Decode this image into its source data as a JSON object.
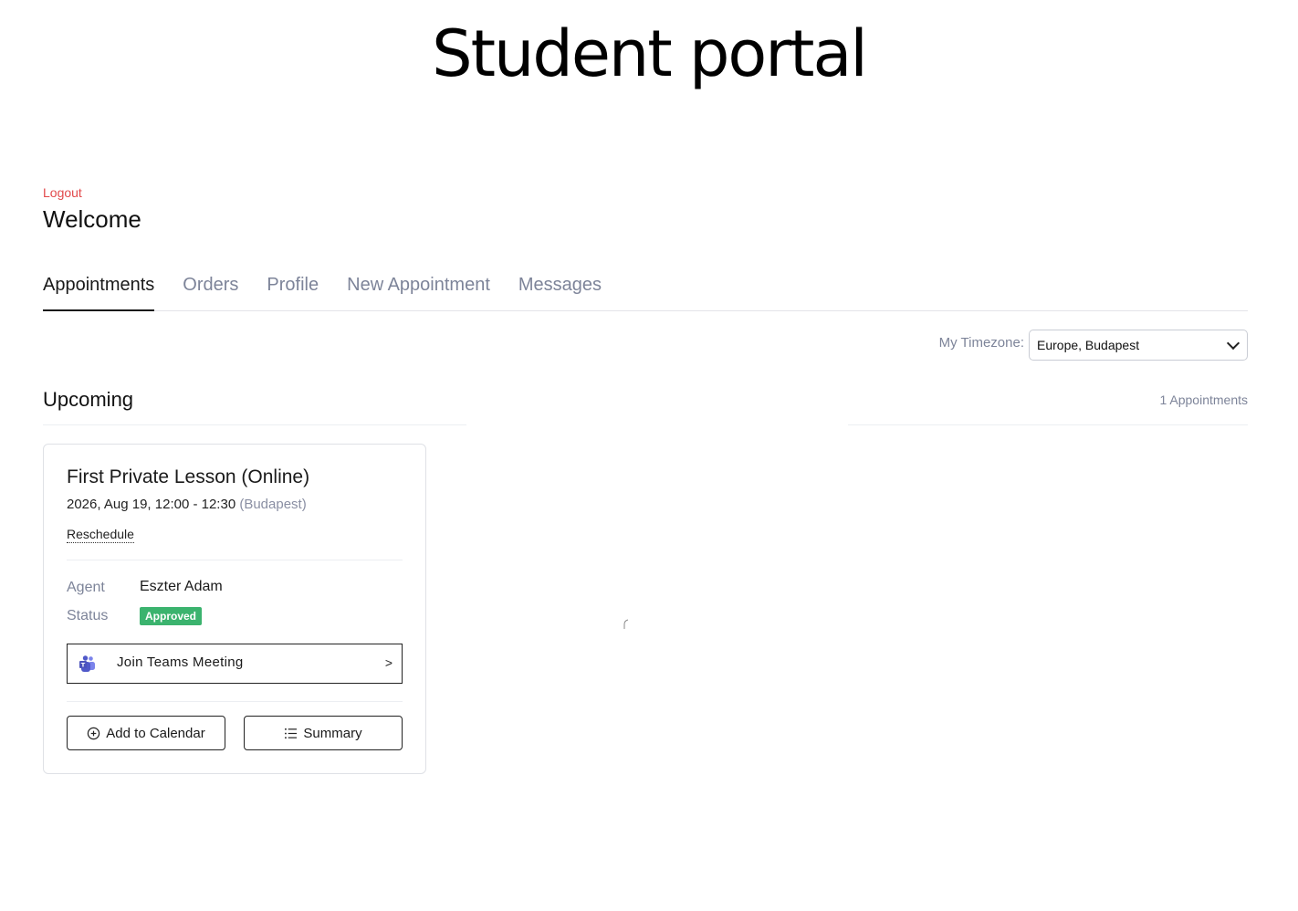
{
  "page": {
    "title": "Student portal"
  },
  "header": {
    "logout_label": "Logout",
    "welcome_text": "Welcome"
  },
  "tabs": [
    {
      "label": "Appointments",
      "active": true
    },
    {
      "label": "Orders",
      "active": false
    },
    {
      "label": "Profile",
      "active": false
    },
    {
      "label": "New Appointment",
      "active": false
    },
    {
      "label": "Messages",
      "active": false
    }
  ],
  "timezone": {
    "label": "My Timezone:",
    "selected": "Europe, Budapest"
  },
  "upcoming": {
    "title": "Upcoming",
    "count_text": "1 Appointments"
  },
  "appointment": {
    "title": "First Private Lesson (Online)",
    "datetime": "2026, Aug 19, 12:00 - 12:30",
    "tz_suffix": "(Budapest)",
    "reschedule_label": "Reschedule",
    "agent_label": "Agent",
    "agent_name": "Eszter Adam",
    "status_label": "Status",
    "status_value": "Approved",
    "teams_label": "Join Teams Meeting",
    "teams_arrow": ">",
    "add_calendar_label": "Add to Calendar",
    "summary_label": "Summary"
  },
  "colors": {
    "logout": "#e2494b",
    "tab_inactive": "#7d8499",
    "status_approved": "#3bb36e"
  },
  "icons": {
    "teams": "teams-icon",
    "add_calendar": "plus-circle-icon",
    "summary": "list-icon"
  }
}
